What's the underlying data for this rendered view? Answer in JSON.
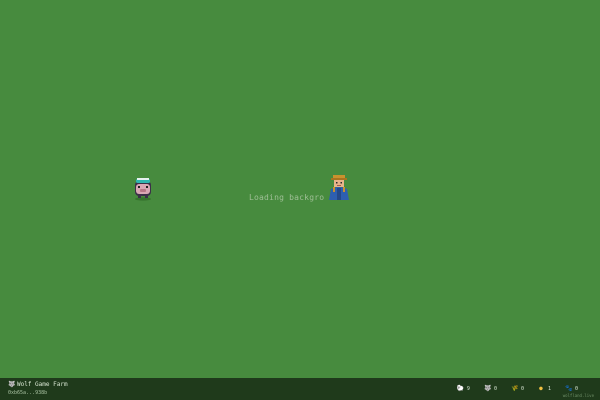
{
  "stage": {
    "loading_text": "Loading backgro"
  },
  "footer": {
    "title": "Wolf Game Farm",
    "wallet": "0xb65a...938b",
    "site": "wolfland.live",
    "stats": [
      {
        "icon": "sheep-icon",
        "glyph": "🐑",
        "value": "9",
        "color": "#f2f2f2"
      },
      {
        "icon": "wolf-icon",
        "glyph": "🐺",
        "value": "0",
        "color": "#b9c4cf"
      },
      {
        "icon": "wheat-icon",
        "glyph": "🌾",
        "value": "0",
        "color": "#e2b84a"
      },
      {
        "icon": "egg-icon",
        "glyph": "●",
        "value": "1",
        "color": "#f0c040"
      },
      {
        "icon": "paw-icon",
        "glyph": "🐾",
        "value": "0",
        "color": "#8fa37b"
      }
    ]
  },
  "colors": {
    "grass": "#478b3e",
    "footer_bg": "#1f3a1b"
  }
}
